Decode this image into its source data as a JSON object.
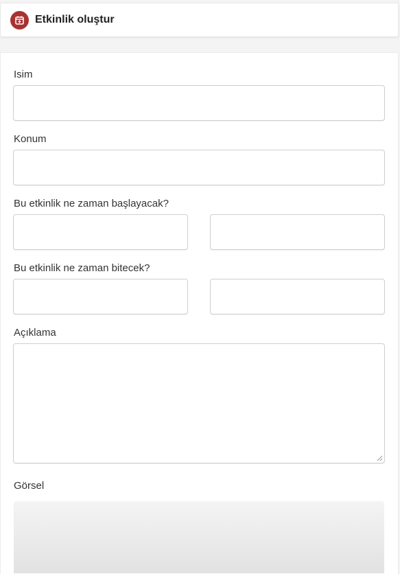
{
  "header": {
    "title": "Etkinlik oluştur",
    "icon": "calendar-plus-icon",
    "accent_color": "#a83232"
  },
  "form": {
    "name_label": "Isim",
    "name_value": "",
    "location_label": "Konum",
    "location_value": "",
    "start_label": "Bu etkinlik ne zaman başlayacak?",
    "start_date_value": "",
    "start_time_value": "",
    "end_label": "Bu etkinlik ne zaman bitecek?",
    "end_date_value": "",
    "end_time_value": "",
    "description_label": "Açıklama",
    "description_value": "",
    "image_label": "Görsel"
  }
}
